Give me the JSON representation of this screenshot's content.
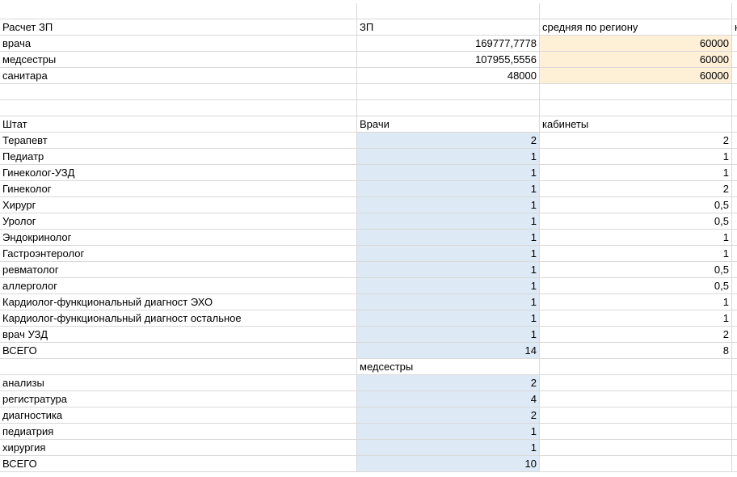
{
  "sheet": {
    "rows": [
      {
        "a": "",
        "b": "",
        "c": "",
        "d": "",
        "b_num": false,
        "c_num": false,
        "b_fill": "",
        "c_fill": ""
      },
      {
        "a": "Расчет ЗП",
        "b": "ЗП",
        "c": "средняя по региону",
        "d": "н",
        "b_num": false,
        "c_num": false,
        "b_fill": "",
        "c_fill": ""
      },
      {
        "a": "врача",
        "b": "169777,7778",
        "c": "60000",
        "d": "",
        "b_num": true,
        "c_num": true,
        "b_fill": "",
        "c_fill": "orange"
      },
      {
        "a": "медсестры",
        "b": "107955,5556",
        "c": "60000",
        "d": "",
        "b_num": true,
        "c_num": true,
        "b_fill": "",
        "c_fill": "orange"
      },
      {
        "a": "санитара",
        "b": "48000",
        "c": "60000",
        "d": "",
        "b_num": true,
        "c_num": true,
        "b_fill": "",
        "c_fill": "orange"
      },
      {
        "a": "",
        "b": "",
        "c": "",
        "d": "",
        "b_num": false,
        "c_num": false,
        "b_fill": "",
        "c_fill": ""
      },
      {
        "a": "",
        "b": "",
        "c": "",
        "d": "",
        "b_num": false,
        "c_num": false,
        "b_fill": "",
        "c_fill": ""
      },
      {
        "a": "Штат",
        "b": "Врачи",
        "c": "кабинеты",
        "d": "",
        "b_num": false,
        "c_num": false,
        "b_fill": "",
        "c_fill": ""
      },
      {
        "a": "Терапевт",
        "b": "2",
        "c": "2",
        "d": "",
        "b_num": true,
        "c_num": true,
        "b_fill": "blue",
        "c_fill": ""
      },
      {
        "a": "Педиатр",
        "b": "1",
        "c": "1",
        "d": "",
        "b_num": true,
        "c_num": true,
        "b_fill": "blue",
        "c_fill": ""
      },
      {
        "a": "Гинеколог-УЗД",
        "b": "1",
        "c": "1",
        "d": "",
        "b_num": true,
        "c_num": true,
        "b_fill": "blue",
        "c_fill": ""
      },
      {
        "a": "Гинеколог",
        "b": "1",
        "c": "2",
        "d": "",
        "b_num": true,
        "c_num": true,
        "b_fill": "blue",
        "c_fill": ""
      },
      {
        "a": "Хирург",
        "b": "1",
        "c": "0,5",
        "d": "",
        "b_num": true,
        "c_num": true,
        "b_fill": "blue",
        "c_fill": ""
      },
      {
        "a": "Уролог",
        "b": "1",
        "c": "0,5",
        "d": "",
        "b_num": true,
        "c_num": true,
        "b_fill": "blue",
        "c_fill": ""
      },
      {
        "a": "Эндокринолог",
        "b": "1",
        "c": "1",
        "d": "",
        "b_num": true,
        "c_num": true,
        "b_fill": "blue",
        "c_fill": ""
      },
      {
        "a": "Гастроэнтеролог",
        "b": "1",
        "c": "1",
        "d": "",
        "b_num": true,
        "c_num": true,
        "b_fill": "blue",
        "c_fill": ""
      },
      {
        "a": "ревматолог",
        "b": "1",
        "c": "0,5",
        "d": "",
        "b_num": true,
        "c_num": true,
        "b_fill": "blue",
        "c_fill": ""
      },
      {
        "a": "аллергolog",
        "b": "1",
        "c": "0,5",
        "d": "",
        "b_num": true,
        "c_num": true,
        "b_fill": "blue",
        "c_fill": ""
      },
      {
        "a": "Кардиолог-функциональный диагност ЭХО",
        "b": "1",
        "c": "1",
        "d": "",
        "b_num": true,
        "c_num": true,
        "b_fill": "blue",
        "c_fill": ""
      },
      {
        "a": "Кардиолог-функциональный диагност остальное",
        "b": "1",
        "c": "1",
        "d": "",
        "b_num": true,
        "c_num": true,
        "b_fill": "blue",
        "c_fill": ""
      },
      {
        "a": "врач УЗД",
        "b": "1",
        "c": "2",
        "d": "",
        "b_num": true,
        "c_num": true,
        "b_fill": "blue",
        "c_fill": ""
      },
      {
        "a": "ВСЕГО",
        "b": "14",
        "c": "8",
        "d": "",
        "b_num": true,
        "c_num": true,
        "b_fill": "blue",
        "c_fill": ""
      },
      {
        "a": "",
        "b": "медсестры",
        "c": "",
        "d": "",
        "b_num": false,
        "c_num": false,
        "b_fill": "",
        "c_fill": ""
      },
      {
        "a": "анализы",
        "b": "2",
        "c": "",
        "d": "",
        "b_num": true,
        "c_num": false,
        "b_fill": "blue",
        "c_fill": ""
      },
      {
        "a": "регистратура",
        "b": "4",
        "c": "",
        "d": "",
        "b_num": true,
        "c_num": false,
        "b_fill": "blue",
        "c_fill": ""
      },
      {
        "a": "диагностика",
        "b": "2",
        "c": "",
        "d": "",
        "b_num": true,
        "c_num": false,
        "b_fill": "blue",
        "c_fill": ""
      },
      {
        "a": "педиатрия",
        "b": "1",
        "c": "",
        "d": "",
        "b_num": true,
        "c_num": false,
        "b_fill": "blue",
        "c_fill": ""
      },
      {
        "a": "хирургия",
        "b": "1",
        "c": "",
        "d": "",
        "b_num": true,
        "c_num": false,
        "b_fill": "blue",
        "c_fill": ""
      },
      {
        "a": "ВСЕГО",
        "b": "10",
        "c": "",
        "d": "",
        "b_num": true,
        "c_num": false,
        "b_fill": "blue",
        "c_fill": ""
      }
    ]
  },
  "colors": {
    "orange_fill": "#fdf0d6",
    "blue_fill": "#dde9f4",
    "gridline": "#d9d9d9"
  }
}
